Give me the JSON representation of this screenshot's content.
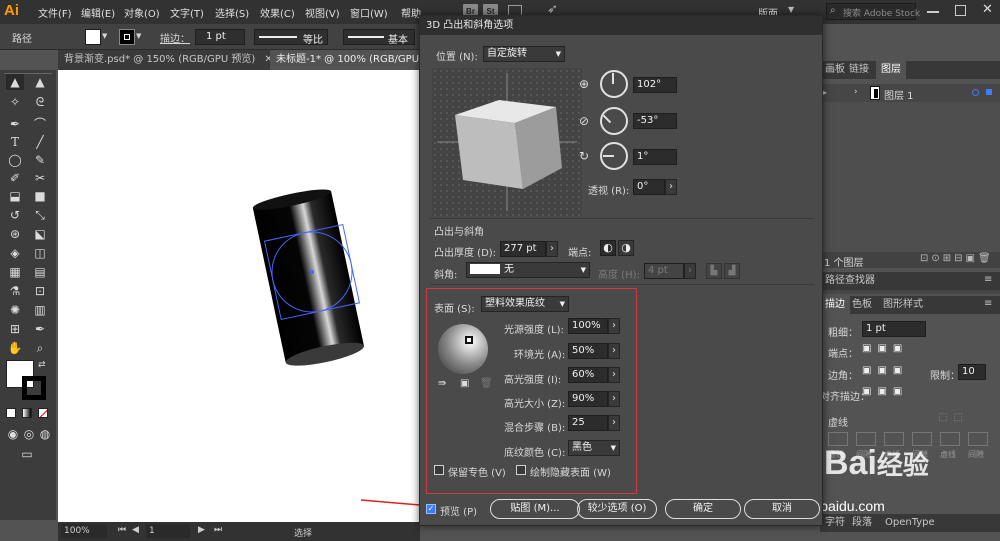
{
  "app": {
    "logo": "Ai"
  },
  "menu": {
    "items": [
      "文件(F)",
      "编辑(E)",
      "对象(O)",
      "文字(T)",
      "选择(S)",
      "效果(C)",
      "视图(V)",
      "窗口(W)",
      "帮助(H)"
    ],
    "bridge": "Br",
    "stock": "St",
    "workspace": "版面",
    "search_placeholder": "搜索 Adobe Stock"
  },
  "control": {
    "selection_label": "路径",
    "stroke_label": "描边：",
    "stroke_weight": "1 pt",
    "profile": "等比",
    "brush": "基本"
  },
  "tabs": [
    {
      "label": "背景渐变.psd* @ 150% (RGB/GPU 预览)"
    },
    {
      "label": "未标题-1* @ 100% (RGB/GPU 预"
    }
  ],
  "status": {
    "zoom": "100%",
    "page": "1",
    "tool": "选择"
  },
  "dialog": {
    "title": "3D 凸出和斜角选项",
    "position_label": "位置 (N):",
    "position_value": "自定旋转",
    "rot_x": "102°",
    "rot_y": "-53°",
    "rot_z": "1°",
    "perspective_label": "透视 (R):",
    "perspective_value": "0°",
    "extrude_section": "凸出与斜角",
    "depth_label": "凸出厚度 (D):",
    "depth_value": "277 pt",
    "cap_label": "端点:",
    "bevel_label": "斜角:",
    "bevel_value": "无",
    "height_label": "高度 (H):",
    "height_value": "4 pt",
    "surface_label": "表面 (S):",
    "surface_value": "塑料效果底纹",
    "light_intensity_label": "光源强度 (L):",
    "light_intensity": "100%",
    "ambient_label": "环境光 (A):",
    "ambient": "50%",
    "highlight_intensity_label": "高光强度 (I):",
    "highlight_intensity": "60%",
    "highlight_size_label": "高光大小 (Z):",
    "highlight_size": "90%",
    "blend_steps_label": "混合步骤 (B):",
    "blend_steps": "25",
    "shading_color_label": "底纹颜色 (C):",
    "shading_color": "黑色",
    "preserve_spot": "保留专色 (V)",
    "draw_hidden": "绘制隐藏表面 (W)",
    "preview_label": "预览 (P)",
    "map_button": "贴图 (M)...",
    "fewer_button": "较少选项 (O)",
    "ok_button": "确定",
    "cancel_button": "取消"
  },
  "panels": {
    "layer_tabs": [
      "画板",
      "链接",
      "图层"
    ],
    "layer_name": "图层 1",
    "layer_count": "1 个图层",
    "pathfinder": "路径查找器",
    "stroke_tabs": [
      "描边",
      "色板",
      "图形样式"
    ],
    "weight_label": "粗细：",
    "weight_value": "1 pt",
    "cap_label": "端点：",
    "corner_label": "边角：",
    "limit_label": "限制：",
    "limit_value": "10",
    "align_label": "对齐描边：",
    "dash_label": "虚线",
    "dash_cells": [
      "虚线",
      "间隙",
      "虚线",
      "间隙",
      "虚线",
      "间隙"
    ],
    "bottom_tabs": [
      "字符",
      "段落",
      "OpenType"
    ]
  },
  "watermark": {
    "brand": "Bai",
    "brand2": "经验",
    "url": "jingyan.baidu.com"
  }
}
